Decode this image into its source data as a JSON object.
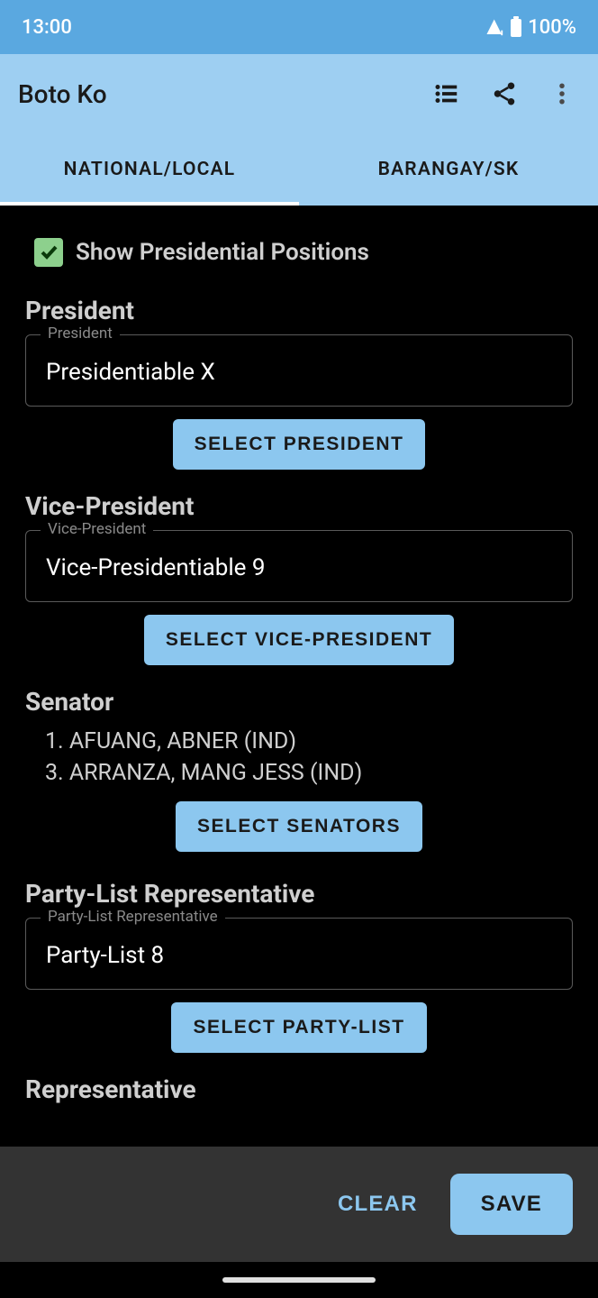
{
  "status": {
    "time": "13:00",
    "battery": "100%"
  },
  "app": {
    "title": "Boto Ko"
  },
  "tabs": {
    "national": "NATIONAL/LOCAL",
    "barangay": "BARANGAY/SK"
  },
  "checkbox": {
    "label": "Show Presidential Positions"
  },
  "president": {
    "title": "President",
    "legend": "President",
    "value": "Presidentiable X",
    "button": "SELECT PRESIDENT"
  },
  "vicePresident": {
    "title": "Vice-President",
    "legend": "Vice-President",
    "value": "Vice-Presidentiable 9",
    "button": "SELECT VICE-PRESIDENT"
  },
  "senator": {
    "title": "Senator",
    "items": [
      "1. AFUANG, ABNER (IND)",
      "3. ARRANZA, MANG JESS (IND)"
    ],
    "button": "SELECT SENATORS"
  },
  "partyList": {
    "title": "Party-List Representative",
    "legend": "Party-List Representative",
    "value": "Party-List 8",
    "button": "SELECT PARTY-LIST"
  },
  "representative": {
    "title": "Representative"
  },
  "actions": {
    "clear": "CLEAR",
    "save": "SAVE"
  }
}
